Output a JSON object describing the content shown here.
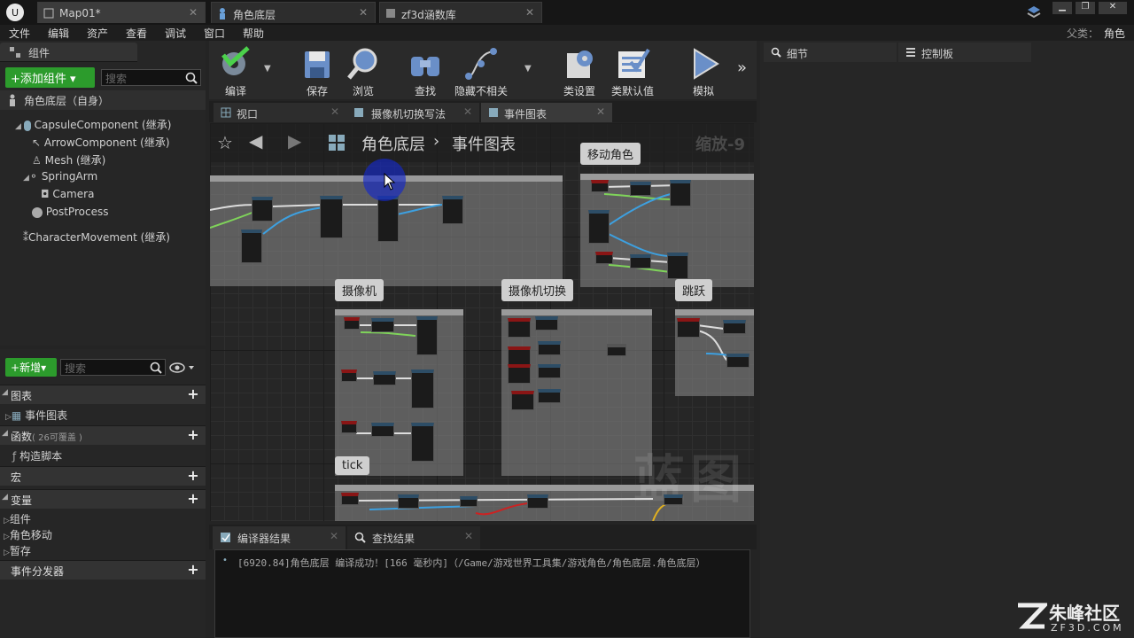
{
  "tabs": [
    {
      "label": "Map01*"
    },
    {
      "label": "角色底层"
    },
    {
      "label": "zf3d涵数库"
    }
  ],
  "menu": [
    "文件",
    "编辑",
    "资产",
    "查看",
    "调试",
    "窗口",
    "帮助"
  ],
  "parent": {
    "label": "父类：",
    "value": "角色"
  },
  "components": {
    "title": "组件",
    "add_label": "添加组件",
    "search_placeholder": "搜索",
    "root": "角色底层（自身）",
    "tree": [
      "CapsuleComponent (继承)",
      "ArrowComponent (继承)",
      "Mesh (继承)",
      "SpringArm",
      "Camera",
      "PostProcess",
      "CharacterMovement (继承)"
    ]
  },
  "mybp": {
    "new_label": "新增",
    "search_placeholder": "搜索",
    "graphs": "图表",
    "event_graph": "事件图表",
    "functions": "函数",
    "functions_note": "( 26可覆盖 )",
    "construction": "构造脚本",
    "macros": "宏",
    "variables": "变量",
    "var_items": [
      "组件",
      "角色移动",
      "暂存"
    ],
    "dispatchers": "事件分发器"
  },
  "toolbar": [
    "编译",
    "保存",
    "浏览",
    "查找",
    "隐藏不相关",
    "类设置",
    "类默认值",
    "模拟"
  ],
  "editor_tabs": [
    "视口",
    "摄像机切换写法",
    "事件图表"
  ],
  "graph": {
    "breadcrumb_root": "角色底层",
    "breadcrumb_leaf": "事件图表",
    "zoom": "缩放-9",
    "watermark": "蓝图",
    "comments": [
      "移动角色",
      "摄像机",
      "摄像机切换",
      "跳跃",
      "tick"
    ]
  },
  "right_tabs": [
    "细节",
    "控制板"
  ],
  "bottom_tabs": [
    "编译器结果",
    "查找结果"
  ],
  "log": "[6920.84]角色底层 编译成功！[166 毫秒内]（/Game/游戏世界工具集/游戏角色/角色底层.角色底层）",
  "brand": {
    "name": "朱峰社区",
    "url": "ZF3D.COM"
  }
}
